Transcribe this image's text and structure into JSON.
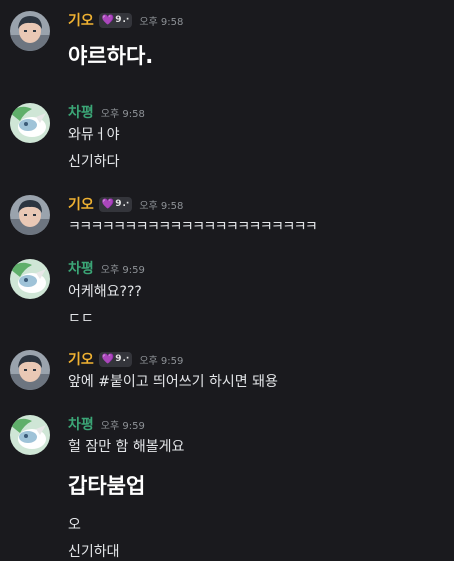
{
  "users": {
    "giho": {
      "name": "기오",
      "badge_text": "9",
      "badge_suffix": ".·",
      "color": "#f0b232"
    },
    "chap": {
      "name": "차평",
      "color": "#3ba576"
    }
  },
  "messages": [
    {
      "user": "기오",
      "time": "오후 9:58",
      "lines": [
        "야르하다."
      ]
    },
    {
      "user": "차평",
      "time": "오후 9:58",
      "lines": [
        "와뮤ㅓ야",
        "신기하다"
      ]
    },
    {
      "user": "기오",
      "time": "오후 9:58",
      "lines": [
        "ㅋㅋㅋㅋㅋㅋㅋㅋㅋㅋㅋㅋㅋㅋㅋㅋㅋㅋㅋㅋㅋㅋ"
      ]
    },
    {
      "user": "차평",
      "time": "오후 9:59",
      "lines": [
        "어케해요???",
        "ㄷㄷ"
      ]
    },
    {
      "user": "기오",
      "time": "오후 9:59",
      "lines": [
        "앞에 #붙이고 띄어쓰기 하시면 돼용"
      ]
    },
    {
      "user": "차평",
      "time": "오후 9:59",
      "lines": [
        "헐 잠만 함 해볼게요",
        "갑타붐업",
        "오",
        "신기하대"
      ]
    }
  ]
}
